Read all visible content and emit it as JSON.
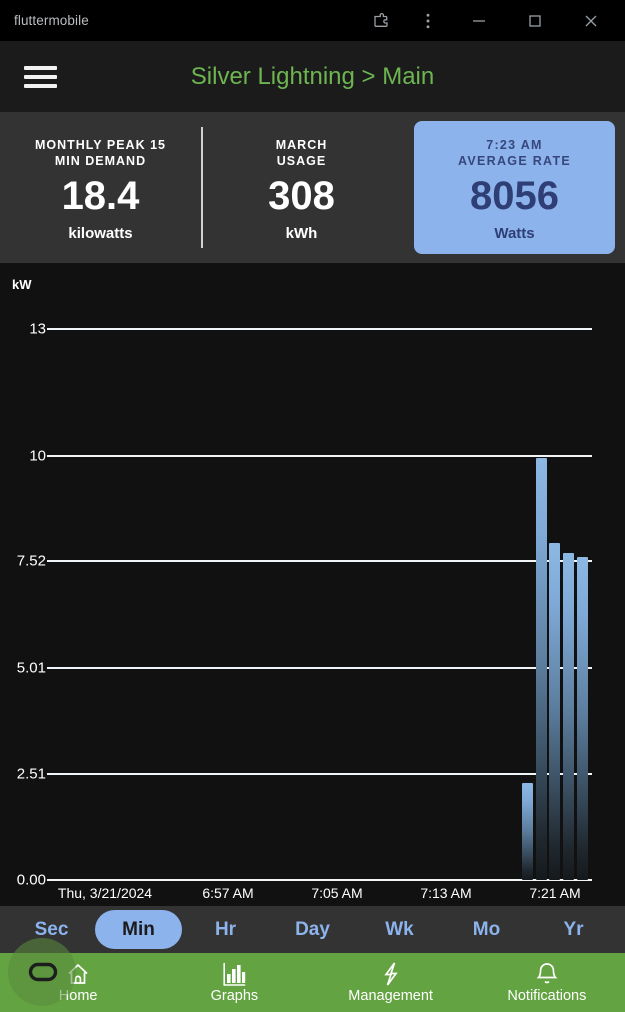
{
  "window": {
    "title": "fluttermobile",
    "buttons": {
      "extension": "extension-icon",
      "menu": "more-vertical-icon",
      "minimize": "—",
      "maximize": "□",
      "close": "✕"
    }
  },
  "appbar": {
    "menu_icon": "hamburger-icon",
    "title": "Silver Lightning > Main"
  },
  "stats": [
    {
      "label_line1": "MONTHLY PEAK 15",
      "label_line2": "MIN DEMAND",
      "value": "18.4",
      "unit": "kilowatts",
      "highlight": false
    },
    {
      "label_line1": "MARCH",
      "label_line2": "USAGE",
      "value": "308",
      "unit": "kWh",
      "highlight": false
    },
    {
      "label_line1": "7:23 AM",
      "label_line2": "AVERAGE RATE",
      "value": "8056",
      "unit": "Watts",
      "highlight": true
    }
  ],
  "colors": {
    "accent_green": "#63a341",
    "title_green": "#6eb552",
    "card_blue": "#8cb3ec",
    "card_text": "#2f3f76",
    "bar_blue": "#8cb8e4",
    "panel_gray": "#333333",
    "chart_bg": "#111111"
  },
  "chart_data": {
    "type": "bar",
    "title": "",
    "xlabel": "",
    "ylabel": "kW",
    "ylim": [
      0,
      13
    ],
    "grid": true,
    "legend": "none",
    "ytick_labels": [
      "13",
      "10",
      "7.52",
      "5.01",
      "2.51",
      "0.00"
    ],
    "ytick_values": [
      13,
      10,
      7.52,
      5.01,
      2.51,
      0.0
    ],
    "xtick_labels": [
      "Thu, 3/21/2024",
      "6:57 AM",
      "7:05 AM",
      "7:13 AM",
      "7:21 AM"
    ],
    "x": [
      "7:19 AM",
      "7:20 AM",
      "7:21 AM",
      "7:22 AM",
      "7:23 AM"
    ],
    "values": [
      2.28,
      9.96,
      7.95,
      7.72,
      7.62
    ]
  },
  "time_tabs": {
    "items": [
      "Sec",
      "Min",
      "Hr",
      "Day",
      "Wk",
      "Mo",
      "Yr"
    ],
    "active": "Min"
  },
  "bottom_nav": {
    "items": [
      {
        "label": "Home",
        "icon": "home-icon"
      },
      {
        "label": "Graphs",
        "icon": "bar-chart-icon"
      },
      {
        "label": "Management",
        "icon": "lightning-bolt-icon"
      },
      {
        "label": "Notifications",
        "icon": "bell-icon"
      }
    ],
    "floating_button": "∞"
  }
}
